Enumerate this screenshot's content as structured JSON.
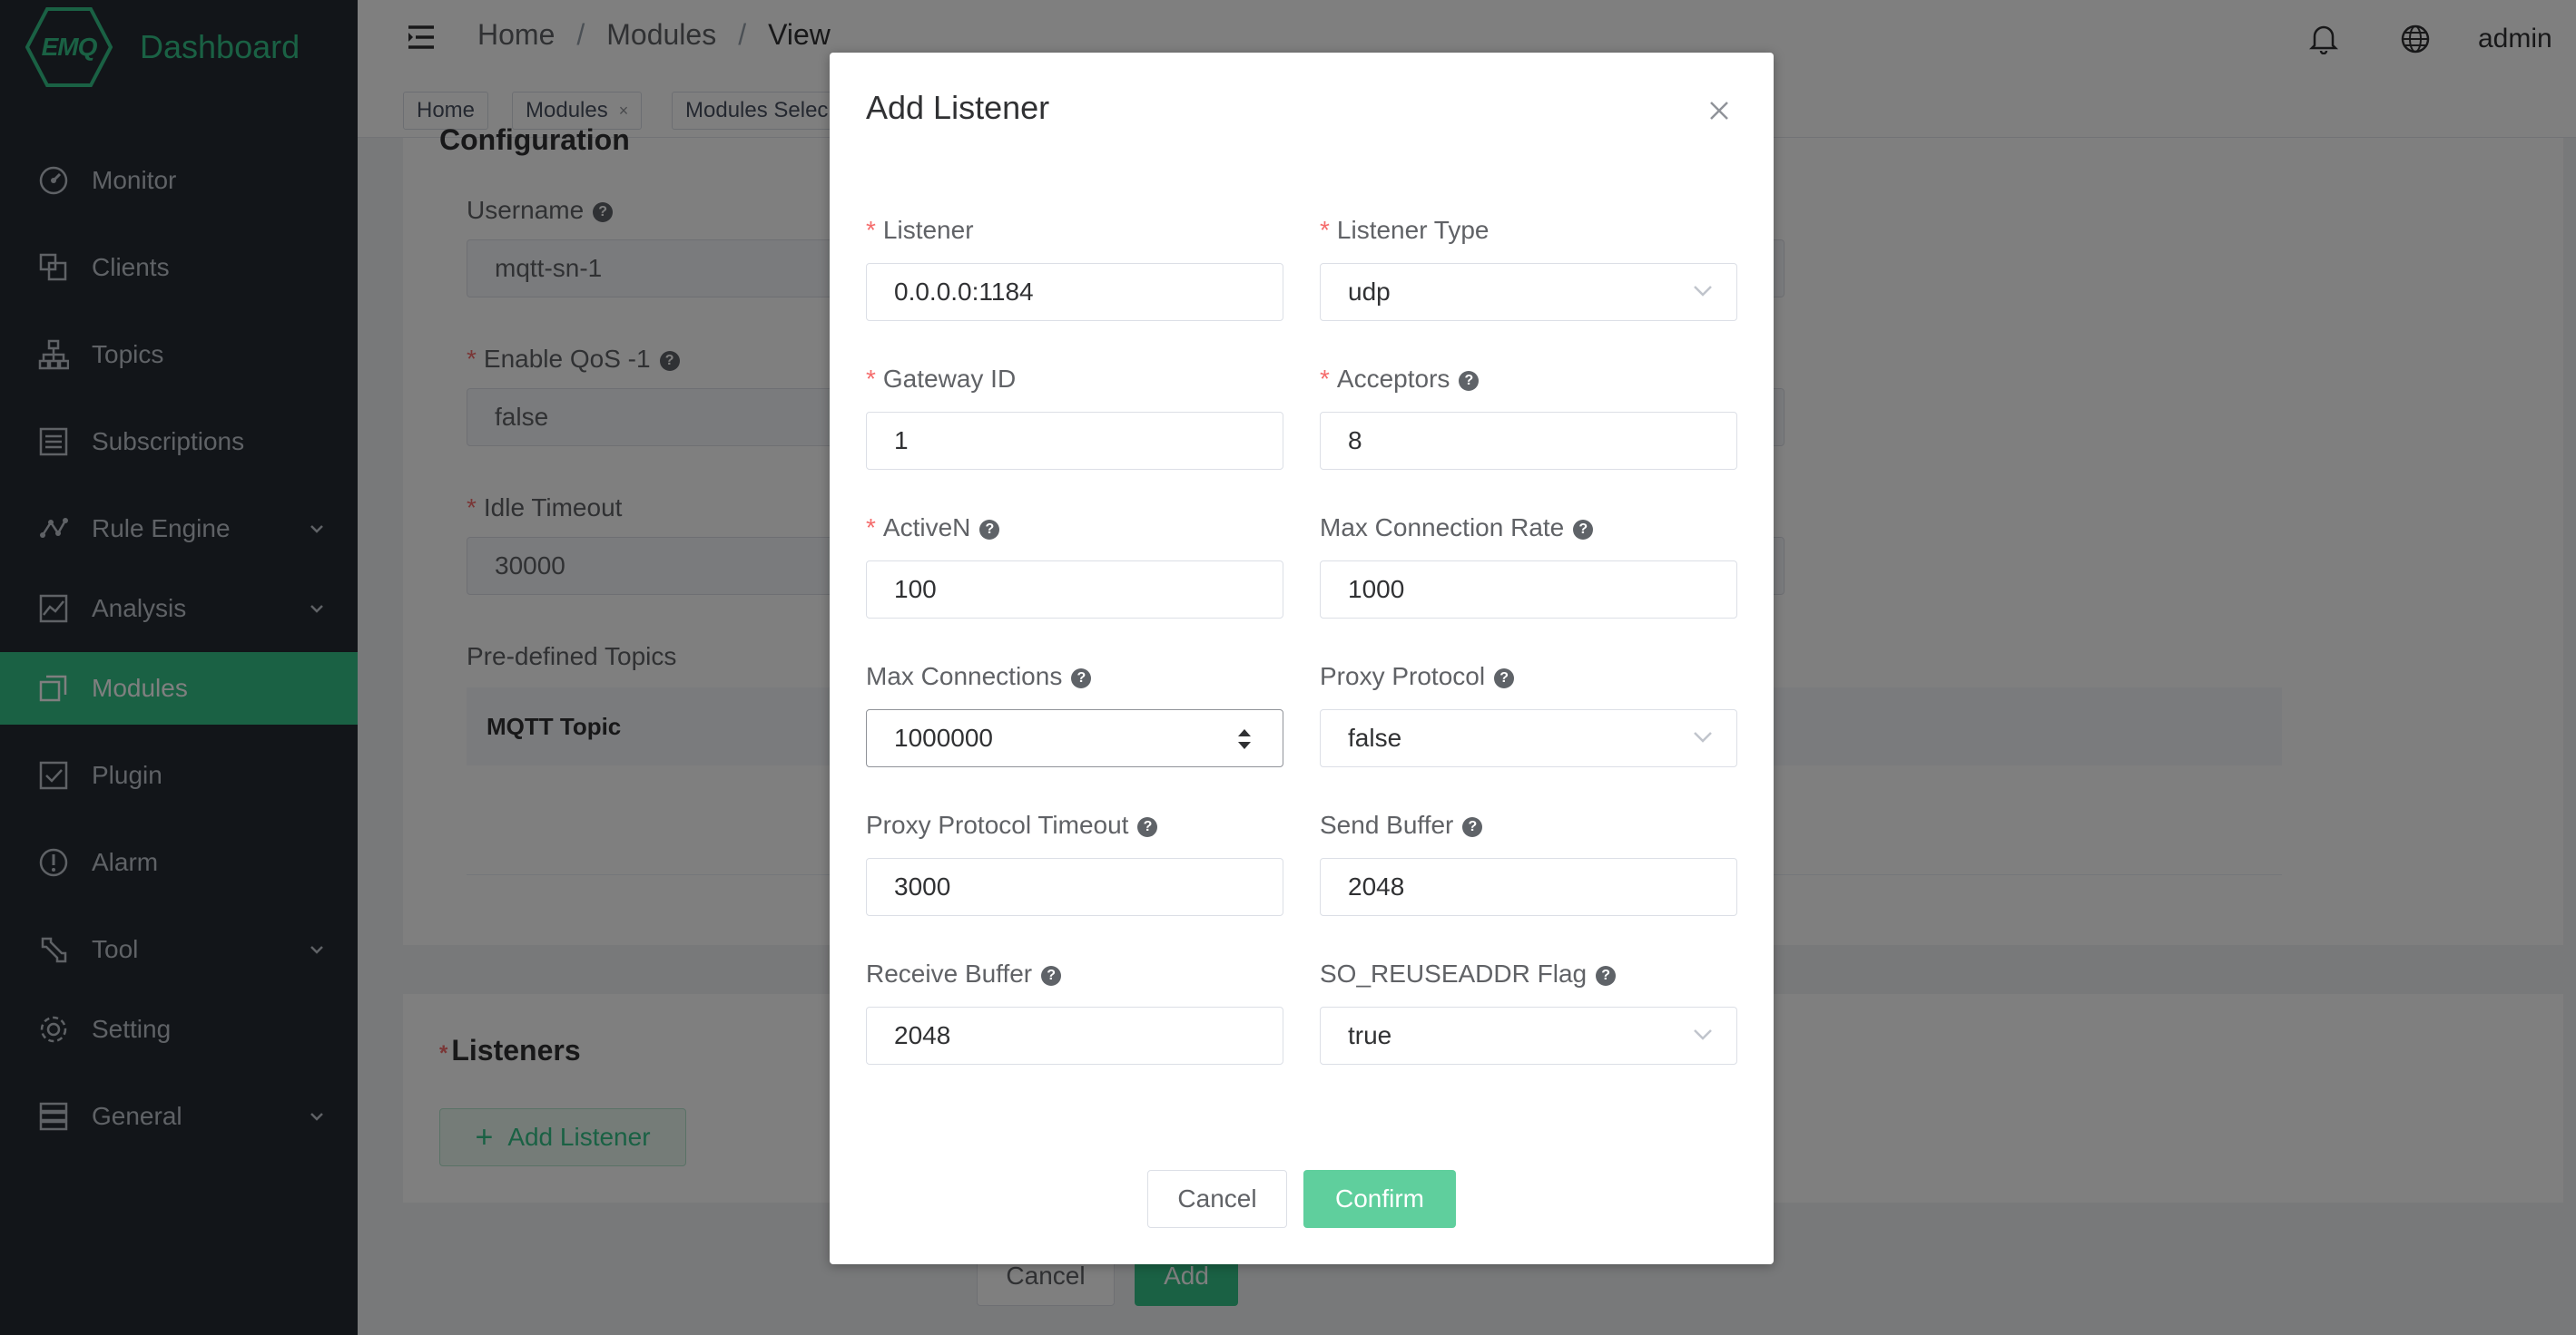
{
  "brand": {
    "logo_text": "EMQ",
    "title": "Dashboard"
  },
  "sidebar": {
    "items": [
      {
        "label": "Monitor",
        "icon": "gauge-icon",
        "has_submenu": false,
        "active": false
      },
      {
        "label": "Clients",
        "icon": "clients-icon",
        "has_submenu": false,
        "active": false
      },
      {
        "label": "Topics",
        "icon": "topics-tree-icon",
        "has_submenu": false,
        "active": false
      },
      {
        "label": "Subscriptions",
        "icon": "subscriptions-list-icon",
        "has_submenu": false,
        "active": false
      },
      {
        "label": "Rule Engine",
        "icon": "rule-engine-icon",
        "has_submenu": true,
        "active": false
      },
      {
        "label": "Analysis",
        "icon": "analysis-chart-icon",
        "has_submenu": true,
        "active": false
      },
      {
        "label": "Modules",
        "icon": "modules-icon",
        "has_submenu": false,
        "active": true
      },
      {
        "label": "Plugin",
        "icon": "plugin-checkbox-icon",
        "has_submenu": false,
        "active": false
      },
      {
        "label": "Alarm",
        "icon": "alarm-exclamation-icon",
        "has_submenu": false,
        "active": false
      },
      {
        "label": "Tool",
        "icon": "tool-wrench-icon",
        "has_submenu": true,
        "active": false
      },
      {
        "label": "Setting",
        "icon": "setting-gear-icon",
        "has_submenu": false,
        "active": false
      },
      {
        "label": "General",
        "icon": "general-server-icon",
        "has_submenu": true,
        "active": false
      }
    ]
  },
  "header": {
    "breadcrumb": [
      "Home",
      "Modules",
      "View"
    ],
    "separator": "/",
    "user": "admin"
  },
  "tags": [
    {
      "label": "Home",
      "closable": false
    },
    {
      "label": "Modules",
      "closable": true,
      "close_glyph": "×"
    },
    {
      "label": "Modules Selec",
      "closable": false
    }
  ],
  "config": {
    "section_title": "Configuration",
    "username_label": "Username",
    "username_value": "mqtt-sn-1",
    "qos_label": "Enable QoS -1",
    "qos_value": "false",
    "idle_label": "Idle Timeout",
    "idle_value": "30000",
    "predefined_label": "Pre-defined Topics",
    "table_header": "MQTT Topic"
  },
  "listeners": {
    "section_title": "Listeners",
    "add_button": "Add Listener",
    "add_icon": "+"
  },
  "bottom_buttons": {
    "cancel": "Cancel",
    "add": "Add"
  },
  "dialog": {
    "title": "Add Listener",
    "close_icon": "close-icon",
    "fields": {
      "listener": {
        "label": "Listener",
        "value": "0.0.0.0:1184",
        "required": true
      },
      "listener_type": {
        "label": "Listener Type",
        "value": "udp",
        "required": true
      },
      "gateway_id": {
        "label": "Gateway ID",
        "value": "1",
        "required": true
      },
      "acceptors": {
        "label": "Acceptors",
        "value": "8",
        "required": true
      },
      "active_n": {
        "label": "ActiveN",
        "value": "100",
        "required": true
      },
      "max_conn_rate": {
        "label": "Max Connection Rate",
        "value": "1000",
        "required": false
      },
      "max_connections": {
        "label": "Max Connections",
        "value": "1000000",
        "required": false
      },
      "proxy_protocol": {
        "label": "Proxy Protocol",
        "value": "false",
        "required": false
      },
      "proxy_timeout": {
        "label": "Proxy Protocol Timeout",
        "value": "3000",
        "required": false
      },
      "send_buffer": {
        "label": "Send Buffer",
        "value": "2048",
        "required": false
      },
      "recv_buffer": {
        "label": "Receive Buffer",
        "value": "2048",
        "required": false
      },
      "reuseaddr": {
        "label": "SO_REUSEADDR Flag",
        "value": "true",
        "required": false
      }
    },
    "help_glyph": "?",
    "required_glyph": "*",
    "cancel": "Cancel",
    "confirm": "Confirm"
  },
  "colors": {
    "accent": "#34c388",
    "sidebar_bg": "#242b33",
    "confirm_bg": "#5fcf9d",
    "required": "#f56c6c"
  }
}
